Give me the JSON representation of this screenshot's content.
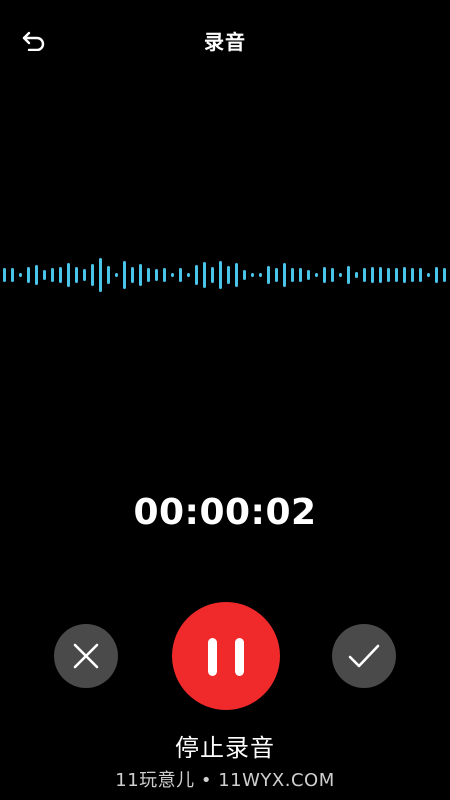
{
  "header": {
    "title": "录音",
    "back_icon": "undo-arrow-icon"
  },
  "waveform": {
    "color": "#49c5ea",
    "levels": [
      0.32,
      0.3,
      0.06,
      0.34,
      0.44,
      0.22,
      0.3,
      0.36,
      0.54,
      0.34,
      0.26,
      0.48,
      0.72,
      0.38,
      0.06,
      0.62,
      0.34,
      0.48,
      0.32,
      0.24,
      0.3,
      0.08,
      0.3,
      0.06,
      0.42,
      0.58,
      0.36,
      0.6,
      0.38,
      0.52,
      0.22,
      0.06,
      0.06,
      0.38,
      0.3,
      0.52,
      0.32,
      0.3,
      0.22,
      0.06,
      0.36,
      0.3,
      0.08,
      0.38,
      0.12,
      0.32,
      0.36,
      0.34,
      0.32,
      0.32,
      0.34,
      0.3,
      0.32,
      0.08,
      0.36,
      0.32
    ]
  },
  "timer": {
    "value": "00:00:02"
  },
  "controls": {
    "cancel_icon": "close-icon",
    "pause_icon": "pause-icon",
    "confirm_icon": "check-icon",
    "side_button_color": "#4a4a4a",
    "record_color": "#f02a2a"
  },
  "stop_label": "停止录音",
  "watermark": "11玩意儿 • 11WYX.COM"
}
